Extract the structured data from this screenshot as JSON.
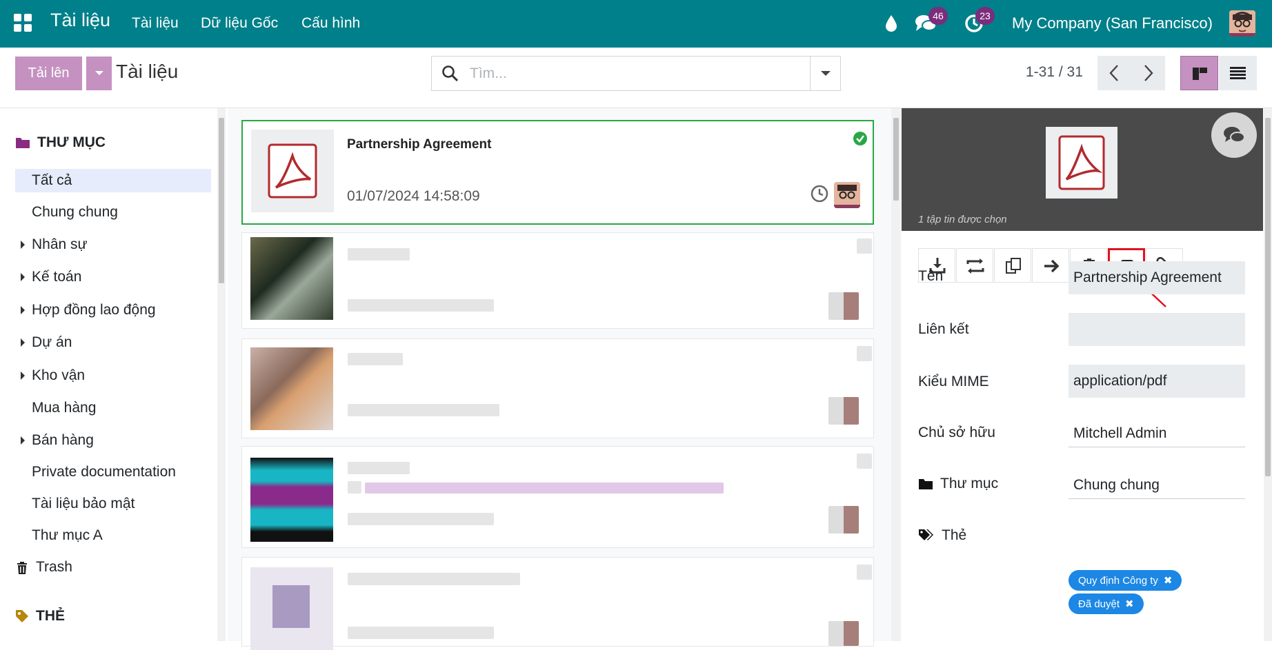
{
  "topbar": {
    "app_title": "Tài liệu",
    "menu": [
      "Tài liệu",
      "Dữ liệu Gốc",
      "Cấu hình"
    ],
    "messages_count": "46",
    "activities_count": "23",
    "company": "My Company (San Francisco)"
  },
  "control": {
    "upload_label": "Tải lên",
    "breadcrumb": "Tài liệu",
    "search_placeholder": "Tìm...",
    "pager": "1-31 / 31"
  },
  "sidebar": {
    "folders_title": "THƯ MỤC",
    "folders": [
      {
        "label": "Tất cả",
        "expandable": false,
        "active": true
      },
      {
        "label": "Chung chung",
        "expandable": false
      },
      {
        "label": "Nhân sự",
        "expandable": true
      },
      {
        "label": "Kế toán",
        "expandable": true
      },
      {
        "label": "Hợp đồng lao động",
        "expandable": true
      },
      {
        "label": "Dự án",
        "expandable": true
      },
      {
        "label": "Kho vận",
        "expandable": true
      },
      {
        "label": "Mua hàng",
        "expandable": false
      },
      {
        "label": "Bán hàng",
        "expandable": true
      },
      {
        "label": "Private documentation",
        "expandable": false
      },
      {
        "label": "Tài liệu bảo mật",
        "expandable": false
      },
      {
        "label": "Thư mục A",
        "expandable": false
      }
    ],
    "trash_label": "Trash",
    "tags_title": "THẺ"
  },
  "documents": [
    {
      "name": "Partnership Agreement",
      "date": "01/07/2024 14:58:09",
      "selected": true,
      "icon": "pdf-icon"
    }
  ],
  "panel": {
    "selection_caption": "1 tập tin được chọn",
    "toolbar_icons": [
      "download-icon",
      "replace-icon",
      "duplicate-icon",
      "move-icon",
      "delete-icon",
      "share-icon",
      "link-icon"
    ],
    "highlighted_tool": "share-icon",
    "fields": {
      "name_label": "Tên",
      "name_value": "Partnership Agreement",
      "url_label": "Liên kết",
      "url_value": "",
      "mime_label": "Kiểu MIME",
      "mime_value": "application/pdf",
      "owner_label": "Chủ sở hữu",
      "owner_value": "Mitchell Admin",
      "folder_label": "Thư mục",
      "folder_value": "Chung chung",
      "tags_label": "Thẻ"
    },
    "tags": [
      "Quy định Công ty",
      "Đã duyệt"
    ]
  },
  "colors": {
    "topbar": "#00808a",
    "primary": "#c491c1",
    "tag": "#1c87e5",
    "selected_border": "#28a745"
  }
}
